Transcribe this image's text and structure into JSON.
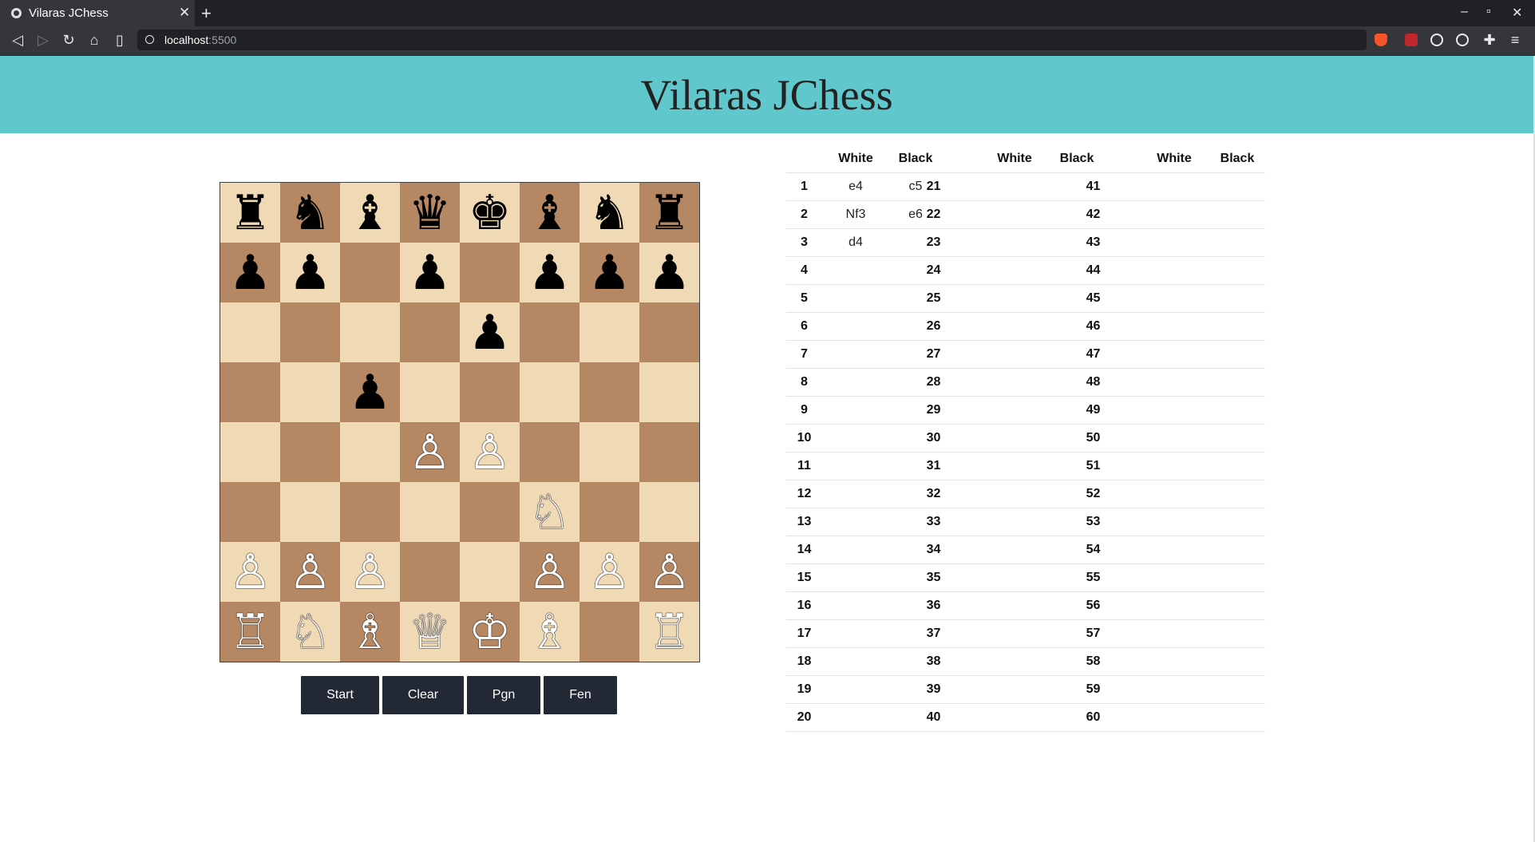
{
  "browser": {
    "tab_title": "Vilaras JChess",
    "url_host": "localhost",
    "url_port": ":5500"
  },
  "page": {
    "title": "Vilaras JChess"
  },
  "board": {
    "ranks": [
      [
        "♜",
        "♞",
        "♝",
        "♛",
        "♚",
        "♝",
        "♞",
        "♜"
      ],
      [
        "♟",
        "♟",
        "",
        "♟",
        "",
        "♟",
        "♟",
        "♟"
      ],
      [
        "",
        "",
        "",
        "",
        "♟",
        "",
        "",
        ""
      ],
      [
        "",
        "",
        "♟",
        "",
        "",
        "",
        "",
        ""
      ],
      [
        "",
        "",
        "",
        "♙",
        "♙",
        "",
        "",
        ""
      ],
      [
        "",
        "",
        "",
        "",
        "",
        "♘",
        "",
        ""
      ],
      [
        "♙",
        "♙",
        "♙",
        "",
        "",
        "♙",
        "♙",
        "♙"
      ],
      [
        "♖",
        "♘",
        "♗",
        "♕",
        "♔",
        "♗",
        "",
        "♖"
      ]
    ]
  },
  "controls": {
    "start": "Start",
    "clear": "Clear",
    "pgn": "Pgn",
    "fen": "Fen"
  },
  "moves": {
    "headers": {
      "white": "White",
      "black": "Black"
    },
    "list": [
      {
        "n": 1,
        "white": "e4",
        "black": "c5"
      },
      {
        "n": 2,
        "white": "Nf3",
        "black": "e6"
      },
      {
        "n": 3,
        "white": "d4",
        "black": ""
      }
    ],
    "numbers": [
      [
        1,
        21,
        41
      ],
      [
        2,
        22,
        42
      ],
      [
        3,
        23,
        43
      ],
      [
        4,
        24,
        44
      ],
      [
        5,
        25,
        45
      ],
      [
        6,
        26,
        46
      ],
      [
        7,
        27,
        47
      ],
      [
        8,
        28,
        48
      ],
      [
        9,
        29,
        49
      ],
      [
        10,
        30,
        50
      ],
      [
        11,
        31,
        51
      ],
      [
        12,
        32,
        52
      ],
      [
        13,
        33,
        53
      ],
      [
        14,
        34,
        54
      ],
      [
        15,
        35,
        55
      ],
      [
        16,
        36,
        56
      ],
      [
        17,
        37,
        57
      ],
      [
        18,
        38,
        58
      ],
      [
        19,
        39,
        59
      ],
      [
        20,
        40,
        60
      ]
    ]
  },
  "colors": {
    "header_bg": "#60c8cc",
    "light_square": "#f0d9b5",
    "dark_square": "#b58863",
    "button_bg": "#222834"
  }
}
